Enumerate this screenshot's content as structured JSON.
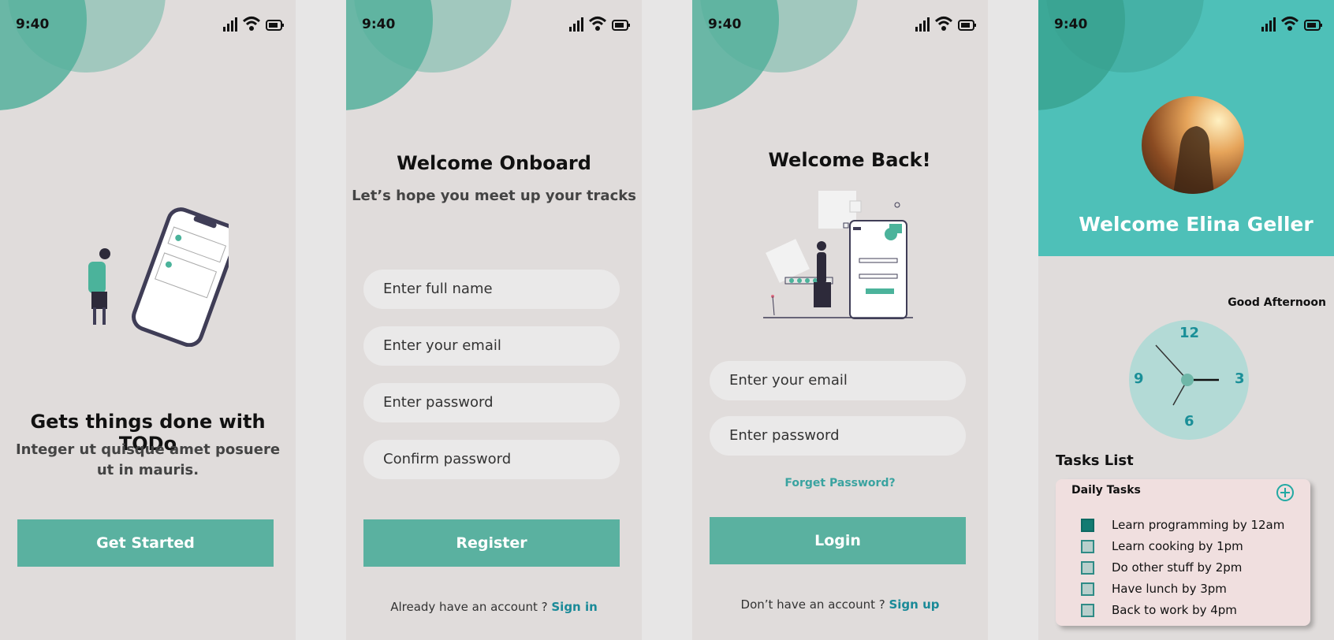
{
  "status": {
    "time": "9:40"
  },
  "screens": [
    {
      "title": "Gets things done with TODo",
      "subtitle_line1": "Integer ut quisque amet posuere",
      "subtitle_line2": "ut in mauris.",
      "button": "Get Started"
    },
    {
      "title": "Welcome Onboard",
      "subtitle": "Let’s hope you meet up your tracks",
      "fields": [
        "Enter full name",
        "Enter your email",
        "Enter password",
        "Confirm password"
      ],
      "button": "Register",
      "footer_text": "Already have an account ?",
      "footer_link": "Sign in"
    },
    {
      "title": "Welcome Back!",
      "fields": [
        "Enter your email",
        "Enter password"
      ],
      "forgot": "Forget Password?",
      "button": "Login",
      "footer_text": "Don’t have an account ?",
      "footer_link": "Sign up"
    },
    {
      "welcome": "Welcome Elina Geller",
      "greeting": "Good Afternoon",
      "clock_numbers": {
        "n12": "12",
        "n3": "3",
        "n6": "6",
        "n9": "9"
      },
      "tasks_heading": "Tasks List",
      "card_title": "Daily Tasks",
      "tasks": [
        {
          "label": "Learn programming by 12am",
          "checked": true
        },
        {
          "label": "Learn cooking by 1pm",
          "checked": false
        },
        {
          "label": "Do other stuff by 2pm",
          "checked": false
        },
        {
          "label": "Have lunch by 3pm",
          "checked": false
        },
        {
          "label": "Back to work by 4pm",
          "checked": false
        }
      ]
    }
  ],
  "colors": {
    "accent": "#5ab1a0",
    "teal_header": "#4ec0b8",
    "link": "#1a8a98"
  }
}
